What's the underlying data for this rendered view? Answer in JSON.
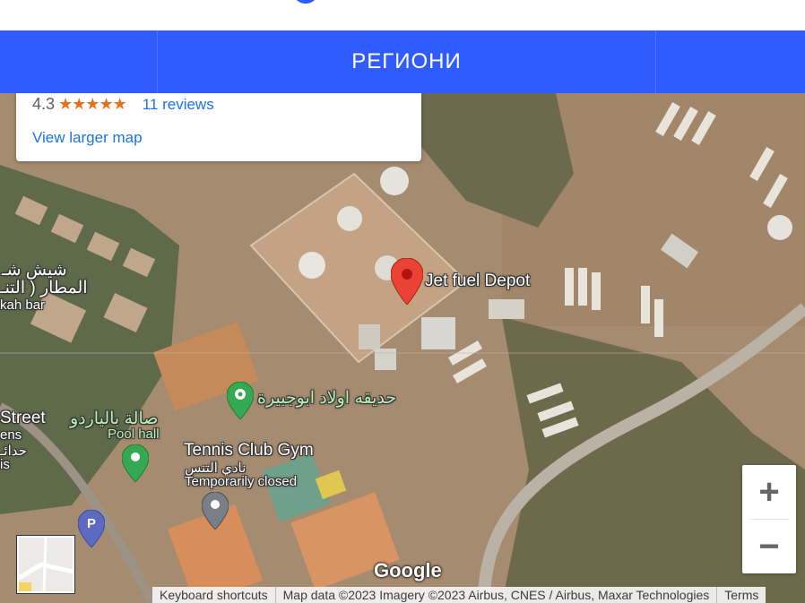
{
  "nav": {
    "region_label": "РЕГИОНИ"
  },
  "infocard": {
    "rating": "4.3",
    "stars": "★★★★★",
    "reviews": "11 reviews",
    "larger_map": "View larger map"
  },
  "places": {
    "jet_fuel": "Jet fuel Depot",
    "garden_ar": "حديقه اولاد ابوجبيرة",
    "pool_ar": "صالة بالياردو",
    "pool_en": "Pool hall",
    "tennis_en": "Tennis Club Gym",
    "tennis_ar": "نادي التنس",
    "tennis_status": "Temporarily closed",
    "left_ar_1": "شيش شـ",
    "left_ar_2": "المطار ( التنـ",
    "left_en_1": "kah bar",
    "left_en_2": "Street",
    "left_en_3": "ens",
    "left_ar_3": "حدائـ",
    "left_en_4": "is"
  },
  "controls": {
    "zoom_in": "+",
    "zoom_out": "−",
    "google_logo": "Google"
  },
  "footer": {
    "shortcuts": "Keyboard shortcuts",
    "mapdata": "Map data ©2023 Imagery ©2023 Airbus, CNES / Airbus, Maxar Technologies",
    "terms": "Terms"
  },
  "colors": {
    "nav_bg": "#2f5bff",
    "link": "#1a73e8",
    "star": "#e7711b",
    "pin_red": "#ea4335",
    "pin_green": "#34a853",
    "pin_gray": "#7a7f87",
    "pin_blue": "#5c6bc0"
  }
}
